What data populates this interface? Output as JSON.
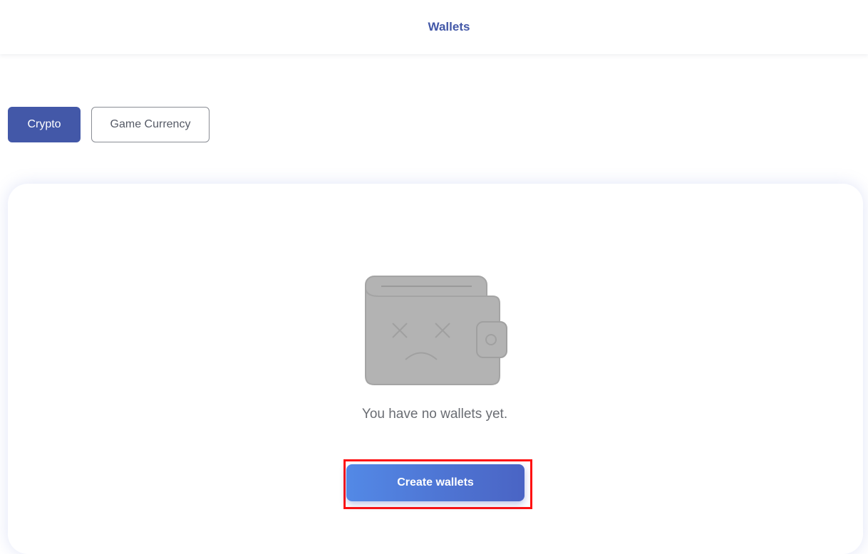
{
  "header": {
    "title": "Wallets"
  },
  "tabs": [
    {
      "label": "Crypto",
      "active": true
    },
    {
      "label": "Game Currency",
      "active": false
    }
  ],
  "empty_state": {
    "icon": "sad-wallet-icon",
    "message": "You have no wallets yet.",
    "create_button_label": "Create wallets"
  },
  "colors": {
    "accent": "#4358a8",
    "button_gradient_start": "#5389e6",
    "button_gradient_end": "#4a64c4",
    "icon_gray": "#b3b3b3",
    "highlight": "#ff1010"
  }
}
